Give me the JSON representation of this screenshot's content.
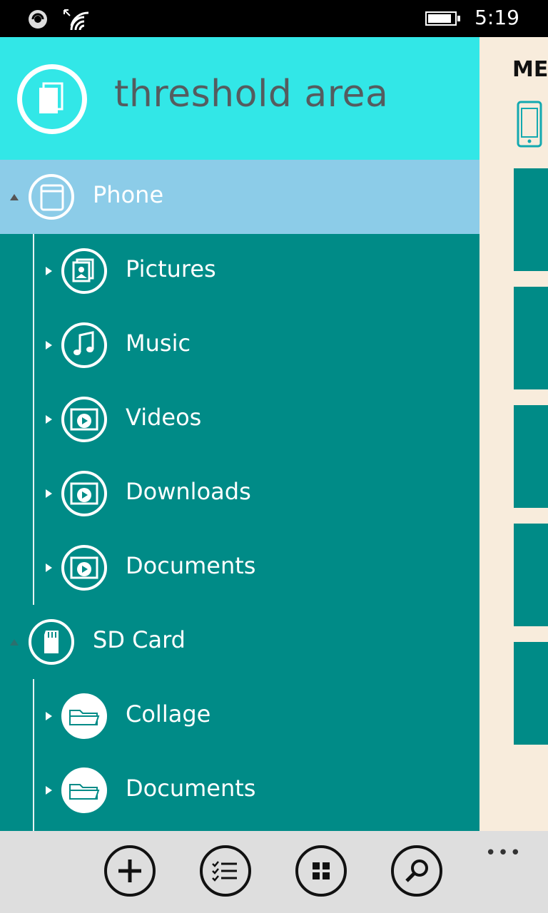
{
  "status": {
    "time": "5:19"
  },
  "header": {
    "title": "threshold area"
  },
  "tree": {
    "phone": {
      "label": "Phone"
    },
    "phone_children": [
      {
        "label": "Pictures"
      },
      {
        "label": "Music"
      },
      {
        "label": "Videos"
      },
      {
        "label": "Downloads"
      },
      {
        "label": "Documents"
      }
    ],
    "sd_card": {
      "label": "SD Card"
    },
    "sd_children": [
      {
        "label": "Collage"
      },
      {
        "label": "Documents"
      }
    ]
  },
  "side_panel": {
    "title": "ME"
  },
  "appbar": {
    "more": "•••"
  },
  "colors": {
    "accent": "#008b87",
    "header": "#32e7e7",
    "selected": "#8ccce8",
    "background": "#f8ecdc"
  },
  "icons": {
    "header": "documents-icon",
    "phone": "phone-icon",
    "pictures": "pictures-icon",
    "music": "music-note-icon",
    "video": "video-play-icon",
    "sd": "sd-card-icon",
    "folder": "folder-icon",
    "add": "add-icon",
    "list": "checklist-icon",
    "grid": "grid-icon",
    "search": "search-icon"
  }
}
